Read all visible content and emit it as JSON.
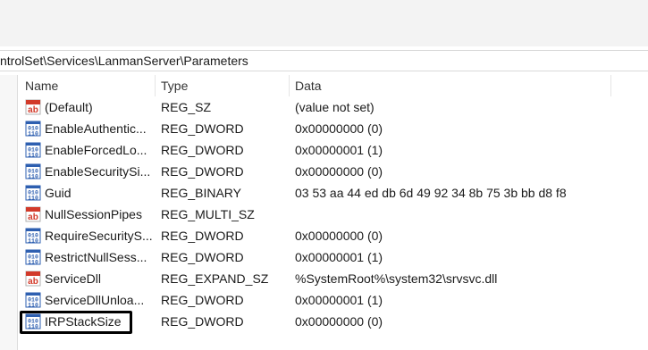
{
  "address": {
    "path": "ntrolSet\\Services\\LanmanServer\\Parameters"
  },
  "columns": {
    "name": "Name",
    "type": "Type",
    "data": "Data"
  },
  "rows": [
    {
      "icon": "string-value-icon",
      "name": "(Default)",
      "type": "REG_SZ",
      "data": "(value not set)"
    },
    {
      "icon": "binary-value-icon",
      "name": "EnableAuthentic...",
      "type": "REG_DWORD",
      "data": "0x00000000 (0)"
    },
    {
      "icon": "binary-value-icon",
      "name": "EnableForcedLo...",
      "type": "REG_DWORD",
      "data": "0x00000001 (1)"
    },
    {
      "icon": "binary-value-icon",
      "name": "EnableSecuritySi...",
      "type": "REG_DWORD",
      "data": "0x00000000 (0)"
    },
    {
      "icon": "binary-value-icon",
      "name": "Guid",
      "type": "REG_BINARY",
      "data": "03 53 aa 44 ed db 6d 49 92 34 8b 75 3b bb d8 f8"
    },
    {
      "icon": "string-value-icon",
      "name": "NullSessionPipes",
      "type": "REG_MULTI_SZ",
      "data": ""
    },
    {
      "icon": "binary-value-icon",
      "name": "RequireSecurityS...",
      "type": "REG_DWORD",
      "data": "0x00000000 (0)"
    },
    {
      "icon": "binary-value-icon",
      "name": "RestrictNullSess...",
      "type": "REG_DWORD",
      "data": "0x00000001 (1)"
    },
    {
      "icon": "string-value-icon",
      "name": "ServiceDll",
      "type": "REG_EXPAND_SZ",
      "data": "%SystemRoot%\\system32\\srvsvc.dll"
    },
    {
      "icon": "binary-value-icon",
      "name": "ServiceDllUnloa...",
      "type": "REG_DWORD",
      "data": "0x00000001 (1)"
    },
    {
      "icon": "binary-value-icon",
      "name": "IRPStackSize",
      "type": "REG_DWORD",
      "data": "0x00000000 (0)",
      "highlighted": true
    }
  ]
}
